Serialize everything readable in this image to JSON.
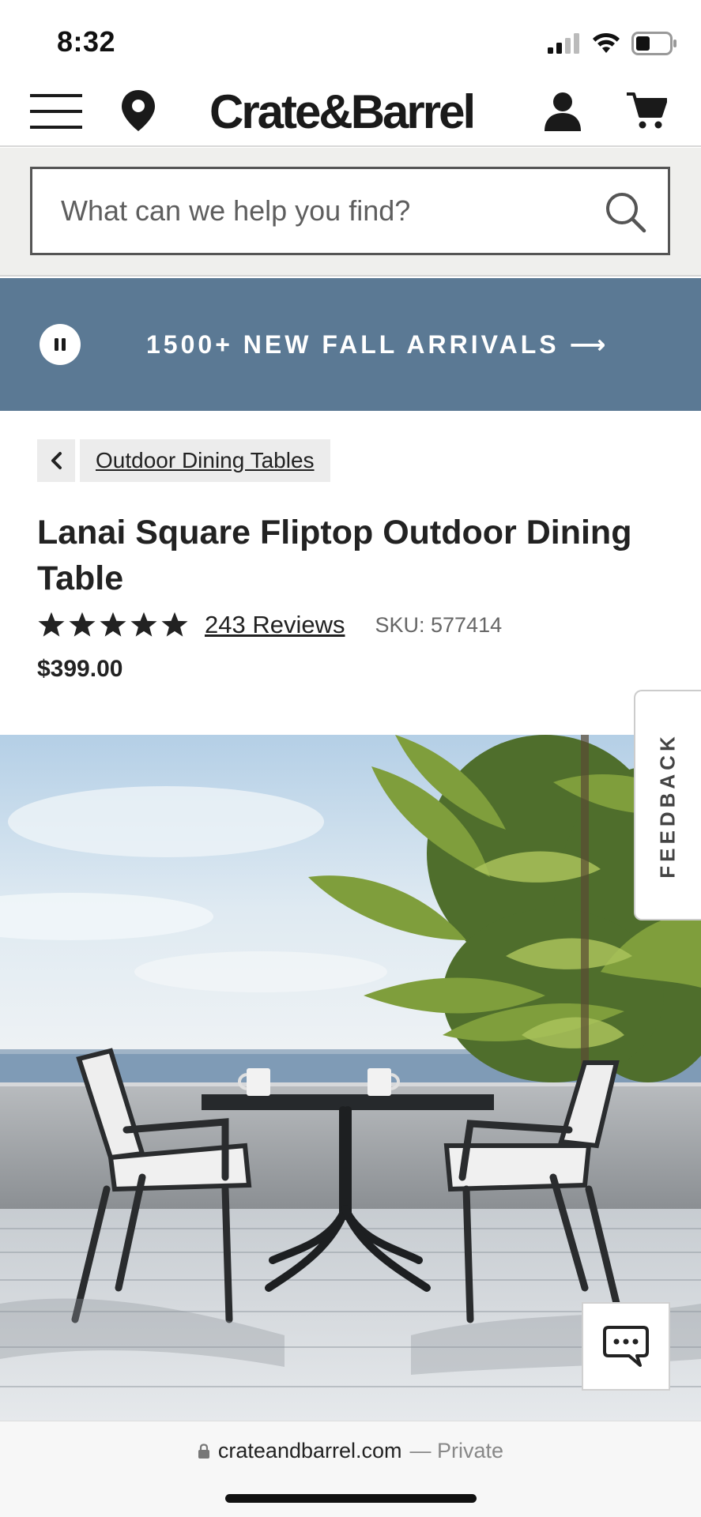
{
  "status_bar": {
    "time": "8:32"
  },
  "header": {
    "logo": "Crate&Barrel",
    "icons": [
      "menu-icon",
      "location-pin-icon",
      "account-icon",
      "cart-icon"
    ]
  },
  "search": {
    "placeholder": "What can we help you find?"
  },
  "promo": {
    "text": "1500+ NEW FALL ARRIVALS ⟶"
  },
  "breadcrumb": {
    "label": "Outdoor Dining Tables"
  },
  "product": {
    "title": "Lanai Square Fliptop Outdoor Dining Table",
    "rating_stars": 5,
    "reviews": "243 Reviews",
    "sku": "SKU: 577414",
    "price": "$399.00"
  },
  "feedback": {
    "label": "FEEDBACK"
  },
  "browser": {
    "domain": "crateandbarrel.com",
    "private": "— Private"
  },
  "colors": {
    "promo_bg": "#5b7994",
    "search_band": "#efefed"
  }
}
